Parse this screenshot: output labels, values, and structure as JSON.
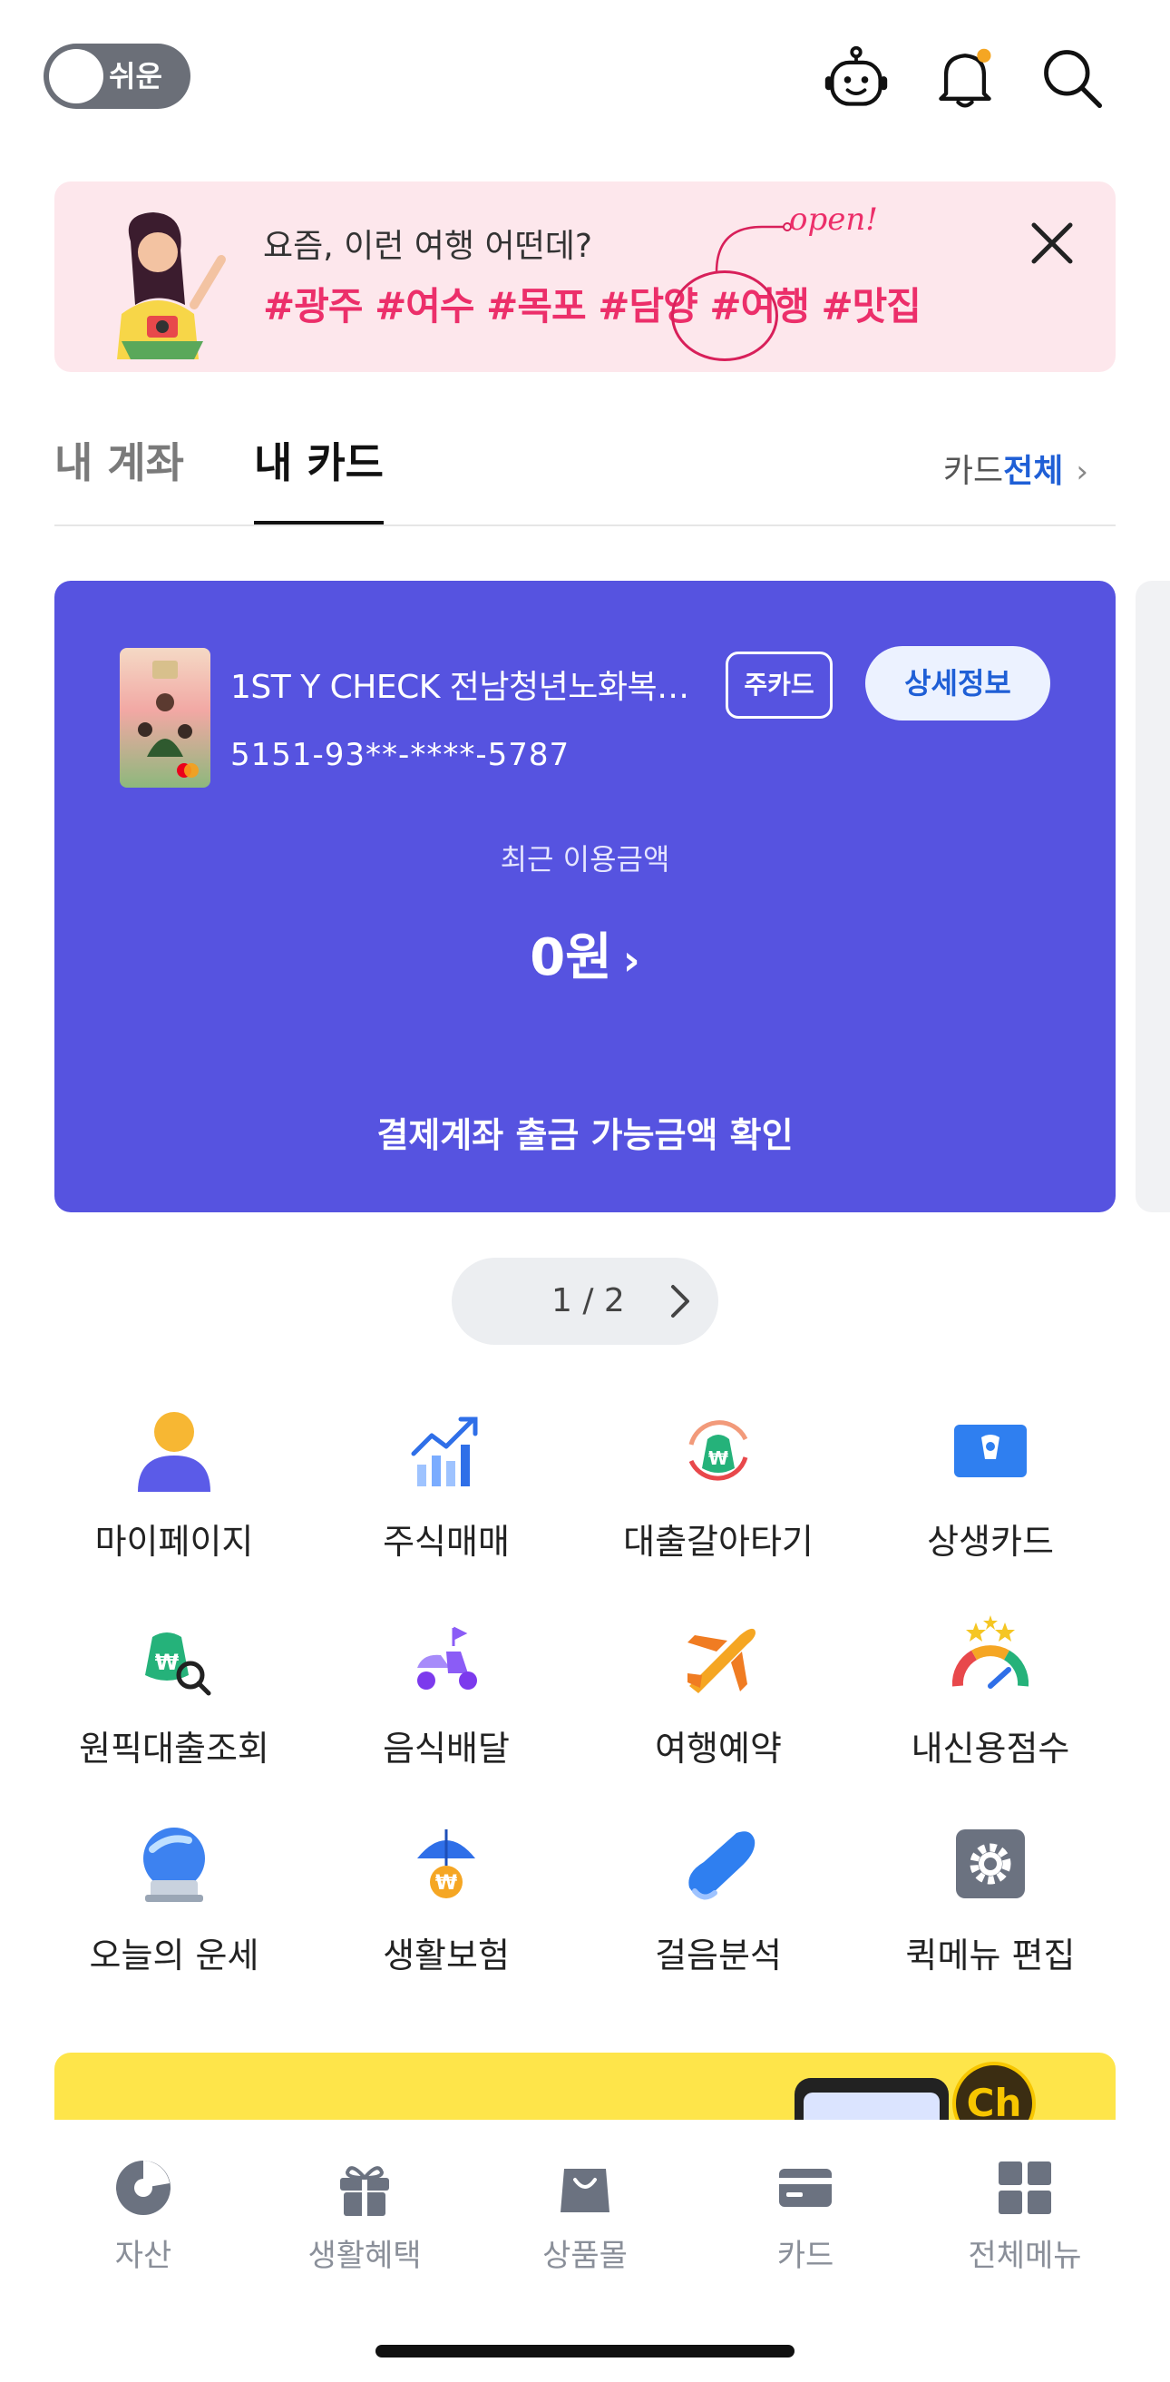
{
  "header": {
    "easy_mode_label": "쉬운",
    "icons": [
      "robot-icon",
      "bell-icon",
      "search-icon"
    ],
    "notification_dot_color": "#f5a623"
  },
  "promo": {
    "line1": "요즘, 이런 여행 어떤데?",
    "line2": "#광주 #여수 #목포 #담양 #여행 #맛집",
    "open_tag": "open!",
    "close_icon": "close-icon"
  },
  "tabs": {
    "items": [
      {
        "label": "내 계좌",
        "active": false
      },
      {
        "label": "내 카드",
        "active": true
      }
    ],
    "card_all_prefix": "카드",
    "card_all_accent": "전체",
    "card_all_chevron": "›"
  },
  "card": {
    "name": "1ST Y CHECK 전남청년노화복…",
    "badge": "주카드",
    "detail_button": "상세정보",
    "number": "5151-93**-****-5787",
    "recent_label": "최근 이용금액",
    "amount": "0원",
    "amount_chevron": "›",
    "check_link": "결제계좌 출금 가능금액 확인",
    "panel_color": "#5653e0"
  },
  "pager": {
    "text": "1 / 2"
  },
  "quick_menu": [
    {
      "label": "마이페이지",
      "icon": "person-icon"
    },
    {
      "label": "주식매매",
      "icon": "stock-chart-icon"
    },
    {
      "label": "대출갈아타기",
      "icon": "loan-switch-icon"
    },
    {
      "label": "상생카드",
      "icon": "sangsaeng-card-icon"
    },
    {
      "label": "원픽대출조회",
      "icon": "loan-search-icon"
    },
    {
      "label": "음식배달",
      "icon": "scooter-icon"
    },
    {
      "label": "여행예약",
      "icon": "airplane-icon"
    },
    {
      "label": "내신용점수",
      "icon": "credit-gauge-icon"
    },
    {
      "label": "오늘의 운세",
      "icon": "crystal-ball-icon"
    },
    {
      "label": "생활보험",
      "icon": "umbrella-icon"
    },
    {
      "label": "걸음분석",
      "icon": "sneaker-icon"
    },
    {
      "label": "퀵메뉴 편집",
      "icon": "gear-icon"
    }
  ],
  "ad": {
    "channel_badge": "Ch"
  },
  "bottom_nav": [
    {
      "label": "자산",
      "icon": "pie-chart-icon"
    },
    {
      "label": "생활혜택",
      "icon": "gift-icon"
    },
    {
      "label": "상품몰",
      "icon": "shopping-bag-icon"
    },
    {
      "label": "카드",
      "icon": "card-icon"
    },
    {
      "label": "전체메뉴",
      "icon": "grid-icon"
    }
  ]
}
